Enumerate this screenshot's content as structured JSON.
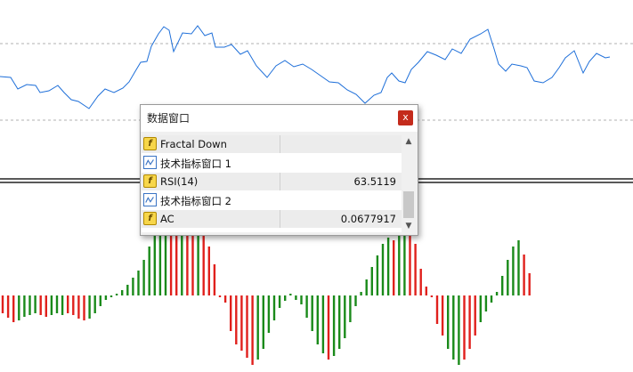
{
  "data_window": {
    "title": "数据窗口",
    "close_label": "x",
    "rows": [
      {
        "kind": "item",
        "icon": "fractal-icon",
        "name": "Fractal Down",
        "value": ""
      },
      {
        "kind": "window",
        "icon": "indicator-window-icon",
        "name": "技术指标窗口 1"
      },
      {
        "kind": "item",
        "icon": "rsi-icon",
        "name": "RSI(14)",
        "value": "63.5119"
      },
      {
        "kind": "window",
        "icon": "indicator-window-icon",
        "name": "技术指标窗口 2"
      },
      {
        "kind": "item",
        "icon": "ac-icon",
        "name": "AC",
        "value": "0.0677917"
      }
    ],
    "scroll_up": "▲",
    "scroll_down": "▼"
  },
  "colors": {
    "line": "#1e6fd9",
    "bar_up": "#1a8a1a",
    "bar_down": "#e0201c",
    "grid": "#b0b0b0",
    "separator": "#222222"
  }
}
